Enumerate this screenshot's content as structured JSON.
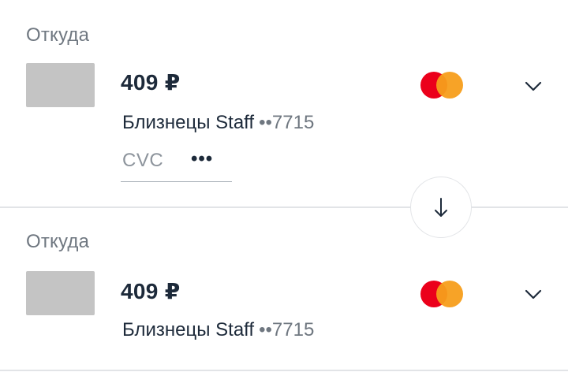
{
  "from_top": {
    "label": "Откуда",
    "amount": "409 ₽",
    "card_name": "Близнецы Staff",
    "card_mask": "••7715",
    "payment_system_icon": "mastercard-logo",
    "expand_icon": "chevron-down-icon",
    "cvc": {
      "placeholder": "CVC",
      "more_label": "•••"
    }
  },
  "swap": {
    "icon": "arrow-down-icon"
  },
  "from_bottom": {
    "label": "Откуда",
    "amount": "409 ₽",
    "card_name": "Близнецы Staff",
    "card_mask": "••7715",
    "payment_system_icon": "mastercard-logo",
    "expand_icon": "chevron-down-icon"
  },
  "colors": {
    "text_primary": "#1d2a3a",
    "text_secondary": "#6f7780",
    "card_placeholder": "#c4c4c4",
    "divider": "#e2e4e7",
    "mastercard_red": "#eb001b",
    "mastercard_orange": "#f79e1b"
  }
}
